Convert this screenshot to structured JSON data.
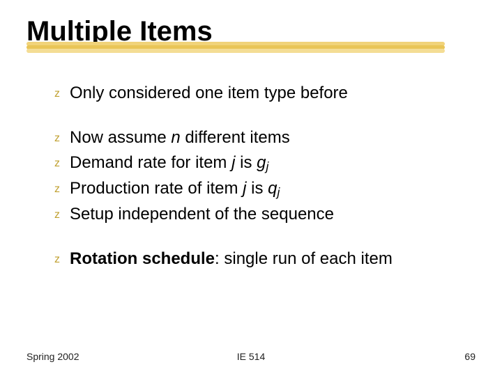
{
  "title": "Multiple Items",
  "underline_colors": [
    "#f1d37a",
    "#e9c557",
    "#f4dd95"
  ],
  "bullet_glyph": "z",
  "groups": [
    {
      "lines": [
        {
          "segments": [
            {
              "t": "Only considered one item type before"
            }
          ]
        }
      ]
    },
    {
      "lines": [
        {
          "segments": [
            {
              "t": "Now assume "
            },
            {
              "t": "n",
              "ital": true
            },
            {
              "t": " different items"
            }
          ]
        },
        {
          "segments": [
            {
              "t": "Demand rate for item "
            },
            {
              "t": "j",
              "ital": true
            },
            {
              "t": " is "
            },
            {
              "t": "g",
              "ital": true
            },
            {
              "t": "j",
              "sub": true
            }
          ]
        },
        {
          "segments": [
            {
              "t": "Production rate of item "
            },
            {
              "t": "j",
              "ital": true
            },
            {
              "t": " is "
            },
            {
              "t": "q",
              "ital": true
            },
            {
              "t": "j",
              "sub": true
            }
          ]
        },
        {
          "segments": [
            {
              "t": "Setup independent of the sequence"
            }
          ]
        }
      ]
    },
    {
      "lines": [
        {
          "segments": [
            {
              "t": "Rotation schedule",
              "bold": true
            },
            {
              "t": ": single run of each item"
            }
          ]
        }
      ]
    }
  ],
  "footer": {
    "left": "Spring 2002",
    "center": "IE 514",
    "right": "69"
  }
}
